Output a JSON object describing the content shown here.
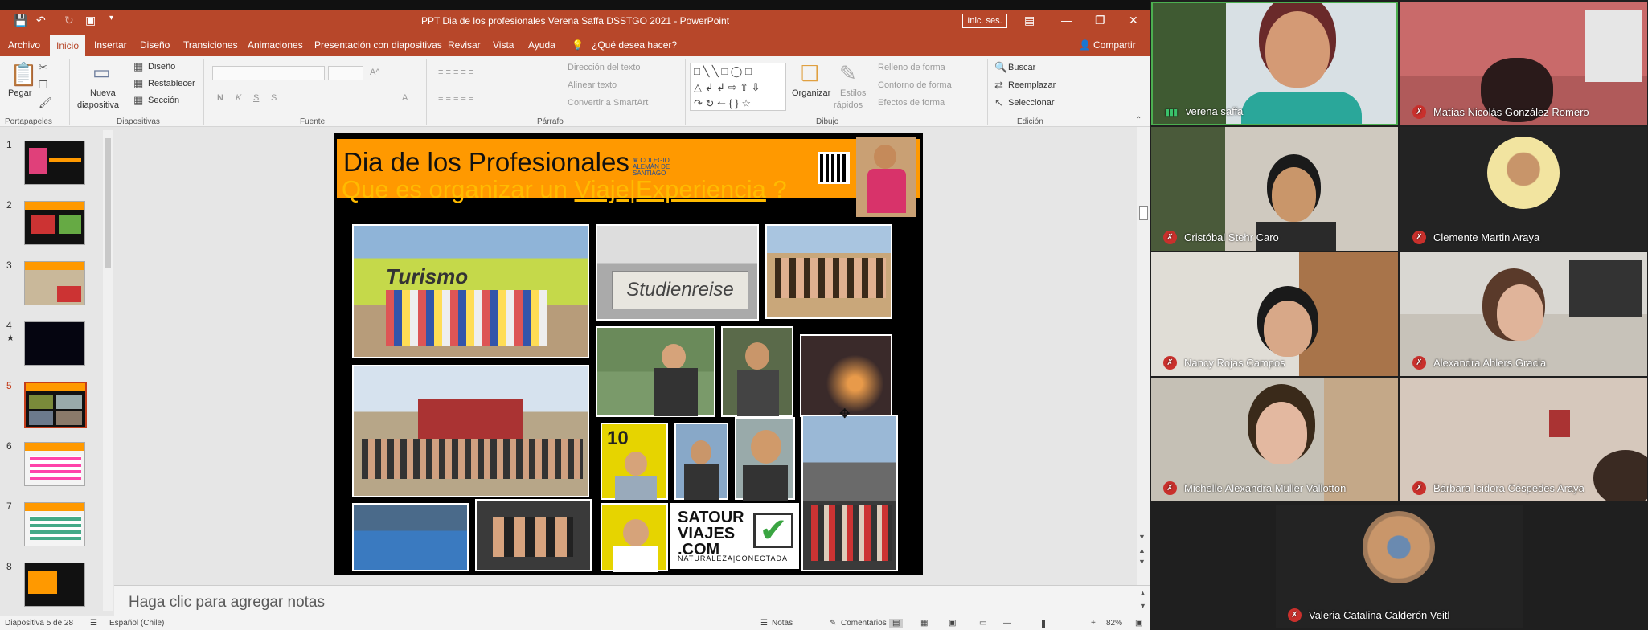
{
  "ppt": {
    "document_title": "PPT Dia de los profesionales Verena Saffa DSSTGO 2021  -  PowerPoint",
    "signin_label": "Inic. ses.",
    "menu_tabs": [
      "Archivo",
      "Inicio",
      "Insertar",
      "Diseño",
      "Transiciones",
      "Animaciones",
      "Presentación con diapositivas",
      "Revisar",
      "Vista",
      "Ayuda"
    ],
    "tell_me": "¿Qué desea hacer?",
    "share_label": "Compartir",
    "ribbon": {
      "paste": "Pegar",
      "new_slide_1": "Nueva",
      "new_slide_2": "diapositiva",
      "design": "Diseño",
      "reset": "Restablecer",
      "section": "Sección",
      "text_direction": "Dirección del texto",
      "align_text": "Alinear texto",
      "convert_smartart": "Convertir a SmartArt",
      "arrange": "Organizar",
      "quick_styles_1": "Estilos",
      "quick_styles_2": "rápidos",
      "shape_fill": "Relleno de forma",
      "shape_outline": "Contorno de forma",
      "shape_effects": "Efectos de forma",
      "find": "Buscar",
      "replace": "Reemplazar",
      "select": "Seleccionar",
      "groups": [
        "Portapapeles",
        "Diapositivas",
        "Fuente",
        "Párrafo",
        "Dibujo",
        "Edición"
      ]
    },
    "thumbnail_numbers": [
      "1",
      "2",
      "3",
      "4",
      "5",
      "6",
      "7",
      "8"
    ],
    "current_slide": "5",
    "slide": {
      "title": "Dia de los Profesionales",
      "subtitle_pre": "Que es organizar un ",
      "subtitle_link": "Viaje|Experiencia",
      "subtitle_post": " ?",
      "school_logo_text": "COLEGIO ALEMÁN DE SANTIAGO",
      "photo_text_turismo": "Turismo",
      "photo_text_studien": "Studienreise",
      "photo_text_ten": "10",
      "satour_line1": "SATOUR",
      "satour_line2": "VIAJES",
      "satour_line3": ".COM",
      "satour_tag": "NATURALEZA|CONECTADA"
    },
    "notes_placeholder": "Haga clic para agregar notas",
    "status": {
      "slide_count": "Diapositiva 5 de 28",
      "language": "Español (Chile)",
      "notes": "Notas",
      "comments": "Comentarios",
      "zoom": "82%"
    }
  },
  "participants": [
    {
      "name": "verena saffa",
      "speaking": true
    },
    {
      "name": "Matías Nicolás González Romero",
      "muted": true
    },
    {
      "name": "Cristóbal Stehr Caro",
      "muted": true
    },
    {
      "name": "Clemente Martin Araya",
      "muted": true
    },
    {
      "name": "Nancy Rojas Campos",
      "muted": true
    },
    {
      "name": "Alexandra Ahlers Gracia",
      "muted": true
    },
    {
      "name": "Michelle Alexandra Müller Vallotton",
      "muted": true
    },
    {
      "name": "Bárbara Isidora Céspedes Araya",
      "muted": true
    },
    {
      "name": "Valeria Catalina Calderón Veitl",
      "muted": true
    }
  ],
  "colors": {
    "accent": "#b7472a",
    "slide_banner": "#ff9900",
    "subtitle": "#ffbb00",
    "mic_muted": "#c9302c",
    "speaking": "#3ac26b"
  }
}
